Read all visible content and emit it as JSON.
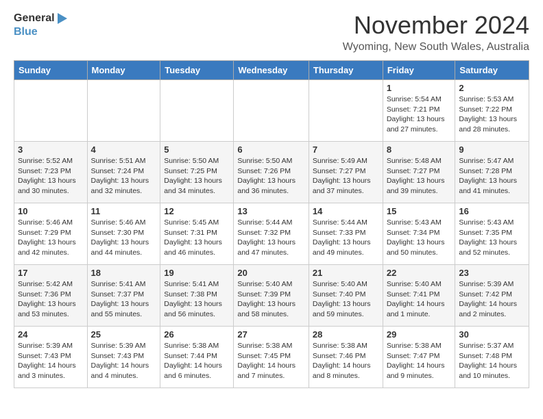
{
  "header": {
    "logo_general": "General",
    "logo_blue": "Blue",
    "month_title": "November 2024",
    "location": "Wyoming, New South Wales, Australia"
  },
  "weekdays": [
    "Sunday",
    "Monday",
    "Tuesday",
    "Wednesday",
    "Thursday",
    "Friday",
    "Saturday"
  ],
  "weeks": [
    [
      {
        "num": "",
        "info": ""
      },
      {
        "num": "",
        "info": ""
      },
      {
        "num": "",
        "info": ""
      },
      {
        "num": "",
        "info": ""
      },
      {
        "num": "",
        "info": ""
      },
      {
        "num": "1",
        "info": "Sunrise: 5:54 AM\nSunset: 7:21 PM\nDaylight: 13 hours and 27 minutes."
      },
      {
        "num": "2",
        "info": "Sunrise: 5:53 AM\nSunset: 7:22 PM\nDaylight: 13 hours and 28 minutes."
      }
    ],
    [
      {
        "num": "3",
        "info": "Sunrise: 5:52 AM\nSunset: 7:23 PM\nDaylight: 13 hours and 30 minutes."
      },
      {
        "num": "4",
        "info": "Sunrise: 5:51 AM\nSunset: 7:24 PM\nDaylight: 13 hours and 32 minutes."
      },
      {
        "num": "5",
        "info": "Sunrise: 5:50 AM\nSunset: 7:25 PM\nDaylight: 13 hours and 34 minutes."
      },
      {
        "num": "6",
        "info": "Sunrise: 5:50 AM\nSunset: 7:26 PM\nDaylight: 13 hours and 36 minutes."
      },
      {
        "num": "7",
        "info": "Sunrise: 5:49 AM\nSunset: 7:27 PM\nDaylight: 13 hours and 37 minutes."
      },
      {
        "num": "8",
        "info": "Sunrise: 5:48 AM\nSunset: 7:27 PM\nDaylight: 13 hours and 39 minutes."
      },
      {
        "num": "9",
        "info": "Sunrise: 5:47 AM\nSunset: 7:28 PM\nDaylight: 13 hours and 41 minutes."
      }
    ],
    [
      {
        "num": "10",
        "info": "Sunrise: 5:46 AM\nSunset: 7:29 PM\nDaylight: 13 hours and 42 minutes."
      },
      {
        "num": "11",
        "info": "Sunrise: 5:46 AM\nSunset: 7:30 PM\nDaylight: 13 hours and 44 minutes."
      },
      {
        "num": "12",
        "info": "Sunrise: 5:45 AM\nSunset: 7:31 PM\nDaylight: 13 hours and 46 minutes."
      },
      {
        "num": "13",
        "info": "Sunrise: 5:44 AM\nSunset: 7:32 PM\nDaylight: 13 hours and 47 minutes."
      },
      {
        "num": "14",
        "info": "Sunrise: 5:44 AM\nSunset: 7:33 PM\nDaylight: 13 hours and 49 minutes."
      },
      {
        "num": "15",
        "info": "Sunrise: 5:43 AM\nSunset: 7:34 PM\nDaylight: 13 hours and 50 minutes."
      },
      {
        "num": "16",
        "info": "Sunrise: 5:43 AM\nSunset: 7:35 PM\nDaylight: 13 hours and 52 minutes."
      }
    ],
    [
      {
        "num": "17",
        "info": "Sunrise: 5:42 AM\nSunset: 7:36 PM\nDaylight: 13 hours and 53 minutes."
      },
      {
        "num": "18",
        "info": "Sunrise: 5:41 AM\nSunset: 7:37 PM\nDaylight: 13 hours and 55 minutes."
      },
      {
        "num": "19",
        "info": "Sunrise: 5:41 AM\nSunset: 7:38 PM\nDaylight: 13 hours and 56 minutes."
      },
      {
        "num": "20",
        "info": "Sunrise: 5:40 AM\nSunset: 7:39 PM\nDaylight: 13 hours and 58 minutes."
      },
      {
        "num": "21",
        "info": "Sunrise: 5:40 AM\nSunset: 7:40 PM\nDaylight: 13 hours and 59 minutes."
      },
      {
        "num": "22",
        "info": "Sunrise: 5:40 AM\nSunset: 7:41 PM\nDaylight: 14 hours and 1 minute."
      },
      {
        "num": "23",
        "info": "Sunrise: 5:39 AM\nSunset: 7:42 PM\nDaylight: 14 hours and 2 minutes."
      }
    ],
    [
      {
        "num": "24",
        "info": "Sunrise: 5:39 AM\nSunset: 7:43 PM\nDaylight: 14 hours and 3 minutes."
      },
      {
        "num": "25",
        "info": "Sunrise: 5:39 AM\nSunset: 7:43 PM\nDaylight: 14 hours and 4 minutes."
      },
      {
        "num": "26",
        "info": "Sunrise: 5:38 AM\nSunset: 7:44 PM\nDaylight: 14 hours and 6 minutes."
      },
      {
        "num": "27",
        "info": "Sunrise: 5:38 AM\nSunset: 7:45 PM\nDaylight: 14 hours and 7 minutes."
      },
      {
        "num": "28",
        "info": "Sunrise: 5:38 AM\nSunset: 7:46 PM\nDaylight: 14 hours and 8 minutes."
      },
      {
        "num": "29",
        "info": "Sunrise: 5:38 AM\nSunset: 7:47 PM\nDaylight: 14 hours and 9 minutes."
      },
      {
        "num": "30",
        "info": "Sunrise: 5:37 AM\nSunset: 7:48 PM\nDaylight: 14 hours and 10 minutes."
      }
    ]
  ]
}
